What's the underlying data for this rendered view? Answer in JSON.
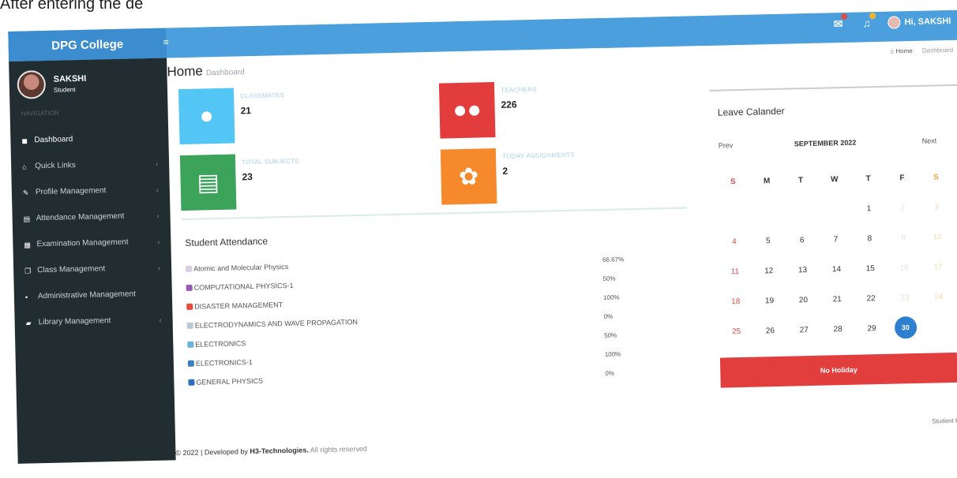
{
  "caption": "After entering the de",
  "brand": "DPG College",
  "topbar": {
    "user_greeting": "Hi, SAKSHI"
  },
  "profile": {
    "name": "SAKSHI",
    "role": "Student"
  },
  "nav_header": "NAVIGATION",
  "nav": [
    {
      "label": "Dashboard",
      "icon": "dashboard-icon",
      "glyph": "◼"
    },
    {
      "label": "Quick Links",
      "icon": "home-icon",
      "glyph": "⌂",
      "chev": "‹"
    },
    {
      "label": "Profile Management",
      "icon": "edit-icon",
      "glyph": "✎",
      "chev": "‹"
    },
    {
      "label": "Attendance Management",
      "icon": "document-icon",
      "glyph": "▤",
      "chev": "‹"
    },
    {
      "label": "Examination Management",
      "icon": "table-icon",
      "glyph": "▦",
      "chev": "‹"
    },
    {
      "label": "Class Management",
      "icon": "copy-icon",
      "glyph": "❐",
      "chev": "‹"
    },
    {
      "label": "Administrative Management",
      "icon": "grid-icon",
      "glyph": "▪"
    },
    {
      "label": "Library Management",
      "icon": "book-icon",
      "glyph": "▰",
      "chev": "‹"
    }
  ],
  "page": {
    "title": "Home",
    "subtitle": "Dashboard"
  },
  "breadcrumb": {
    "home": "Home",
    "current": "Dashboard"
  },
  "stats": [
    {
      "label": "CLASSMATES",
      "value": "21",
      "color": "#54c6f5"
    },
    {
      "label": "TEACHERS",
      "value": "226",
      "color": "#e23c3c"
    },
    {
      "label": "TOTAL SUBJECTS",
      "value": "23",
      "color": "#3ba35a"
    },
    {
      "label": "TODAY ASSIGNMENTS",
      "value": "2",
      "color": "#f5892b"
    }
  ],
  "attendance": {
    "title": "Student Attendance",
    "rows": [
      {
        "subject": "Atomic and Molecular Physics",
        "percent": "66.67%",
        "color": "#d8cfe6"
      },
      {
        "subject": "COMPUTATIONAL PHYSICS-1",
        "percent": "50%",
        "color": "#9b59b6"
      },
      {
        "subject": "DISASTER MANAGEMENT",
        "percent": "100%",
        "color": "#e74c3c"
      },
      {
        "subject": "ELECTRODYNAMICS AND WAVE PROPAGATION",
        "percent": "0%",
        "color": "#b8c7d9"
      },
      {
        "subject": "ELECTRONICS",
        "percent": "50%",
        "color": "#6ab2e0"
      },
      {
        "subject": "ELECTRONICS-1",
        "percent": "100%",
        "color": "#3a7fc2"
      },
      {
        "subject": "GENERAL PHYSICS",
        "percent": "0%",
        "color": "#2f6fc0"
      }
    ]
  },
  "calendar": {
    "title": "Leave Calander",
    "prev": "Prev",
    "next": "Next",
    "month": "SEPTEMBER 2022",
    "days_of_week": [
      "S",
      "M",
      "T",
      "W",
      "T",
      "F",
      "S"
    ],
    "weeks": [
      [
        "",
        "",
        "",
        "",
        "1",
        "2",
        "3"
      ],
      [
        "4",
        "5",
        "6",
        "7",
        "8",
        "9",
        "10"
      ],
      [
        "11",
        "12",
        "13",
        "14",
        "15",
        "16",
        "17"
      ],
      [
        "18",
        "19",
        "20",
        "21",
        "22",
        "23",
        "24"
      ],
      [
        "25",
        "26",
        "27",
        "28",
        "29",
        "30",
        ""
      ]
    ],
    "today": "30",
    "holiday_label": "No Holiday"
  },
  "footer": {
    "prefix": "© 2022 | Developed by",
    "company": "H3-Technologies.",
    "suffix": "All rights reserved"
  },
  "side_note": "Student Pa"
}
